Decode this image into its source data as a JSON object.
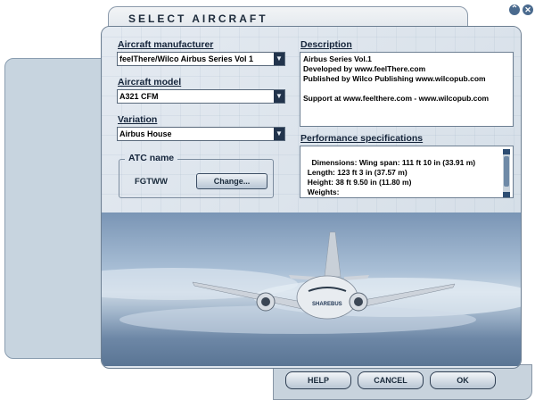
{
  "window": {
    "title": "SELECT AIRCRAFT"
  },
  "title_icons": {
    "minimize": "chevron-up-icon",
    "close": "close-icon"
  },
  "manufacturer": {
    "label": "Aircraft manufacturer",
    "value": "feelThere/Wilco Airbus Series Vol 1"
  },
  "model": {
    "label": "Aircraft model",
    "value": "A321 CFM"
  },
  "variation": {
    "label": "Variation",
    "value": "Airbus House"
  },
  "atc": {
    "label": "ATC name",
    "value": "FGTWW",
    "change_label": "Change..."
  },
  "description": {
    "label": "Description",
    "text": "Airbus Series Vol.1\nDeveloped by www.feelThere.com\nPublished by Wilco Publishing www.wilcopub.com\n\nSupport at www.feelthere.com - www.wilcopub.com"
  },
  "performance": {
    "label": "Performance specifications",
    "text": "Dimensions: Wing span: 111 ft 10 in (33.91 m)\n  Length: 123 ft 3 in (37.57 m)\n  Height: 38 ft 9.50 in (11.80 m)\n  Weights:"
  },
  "buttons": {
    "help": "HELP",
    "cancel": "CANCEL",
    "ok": "OK"
  },
  "preview": {
    "livery_text": "SHAREBUS"
  },
  "colors": {
    "panel": "#dfe6ee",
    "accent": "#22344c",
    "sky": "#8aa4c2"
  }
}
